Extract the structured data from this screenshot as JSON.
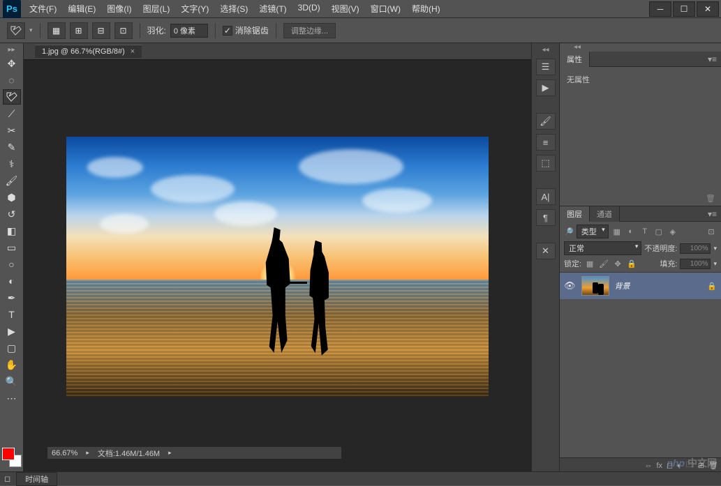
{
  "app": {
    "logo": "Ps"
  },
  "menu": [
    "文件(F)",
    "编辑(E)",
    "图像(I)",
    "图层(L)",
    "文字(Y)",
    "选择(S)",
    "滤镜(T)",
    "3D(D)",
    "视图(V)",
    "窗口(W)",
    "帮助(H)"
  ],
  "options": {
    "feather_label": "羽化:",
    "feather_value": "0 像素",
    "antialias_label": "消除锯齿",
    "refine_label": "调整边缘..."
  },
  "document": {
    "tab_title": "1.jpg @ 66.7%(RGB/8#)",
    "zoom": "66.67%",
    "doc_info": "文档:1.46M/1.46M"
  },
  "properties": {
    "tab": "属性",
    "body": "无属性"
  },
  "layers_panel": {
    "tab1": "图层",
    "tab2": "通道",
    "filter_label": "类型",
    "blend_mode": "正常",
    "opacity_label": "不透明度:",
    "opacity_value": "100%",
    "lock_label": "锁定:",
    "fill_label": "填充:",
    "fill_value": "100%",
    "layer_name": "背景"
  },
  "bottom": {
    "timeline": "时间轴"
  },
  "watermark": {
    "php": "php",
    "cn": "中文网"
  }
}
